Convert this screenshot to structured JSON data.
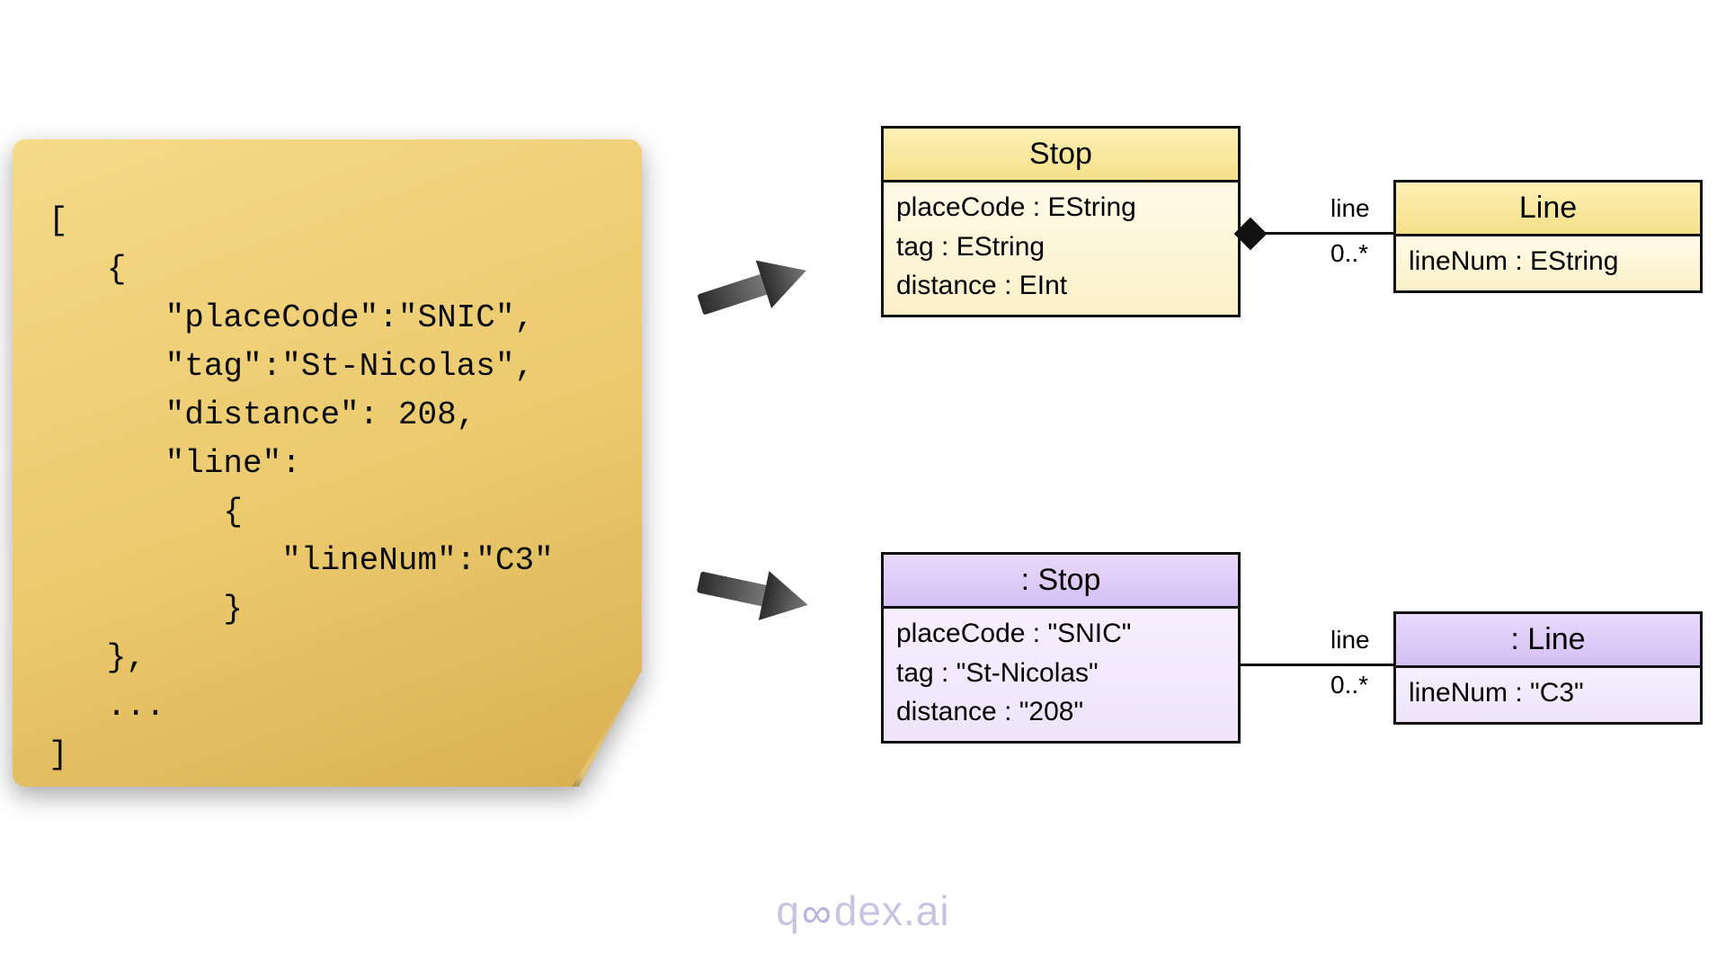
{
  "json_snippet": {
    "lines": [
      "[",
      "   {",
      "      \"placeCode\":\"SNIC\",",
      "      \"tag\":\"St-Nicolas\",",
      "      \"distance\": 208,",
      "      \"line\":",
      "         {",
      "            \"lineNum\":\"C3\"",
      "         }",
      "   },",
      "   ...",
      "]"
    ]
  },
  "class_diagram": {
    "stop": {
      "title": "Stop",
      "attrs": [
        "placeCode : EString",
        "tag : EString",
        "distance : EInt"
      ]
    },
    "line": {
      "title": "Line",
      "attrs": [
        "lineNum : EString"
      ]
    },
    "assoc": {
      "role": "line",
      "multiplicity": "0..*"
    }
  },
  "object_diagram": {
    "stop": {
      "title": ": Stop",
      "attrs": [
        "placeCode : \"SNIC\"",
        "tag : \"St-Nicolas\"",
        "distance : \"208\""
      ]
    },
    "line": {
      "title": ": Line",
      "attrs": [
        "lineNum : \"C3\""
      ]
    },
    "assoc": {
      "role": "line",
      "multiplicity": "0..*"
    }
  },
  "watermark": {
    "prefix": "q",
    "suffix": "dex.ai"
  }
}
